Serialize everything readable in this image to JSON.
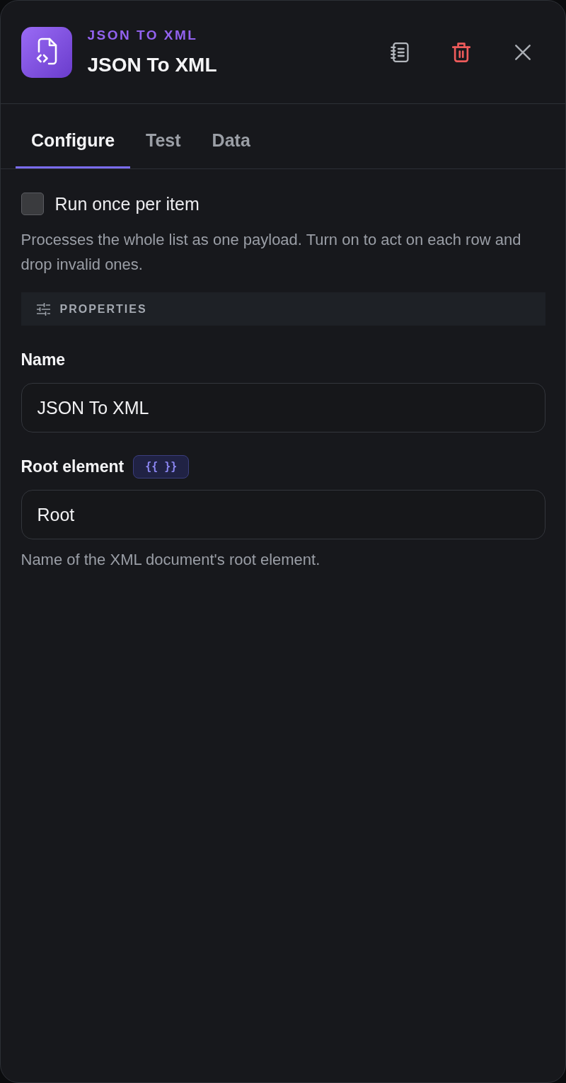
{
  "header": {
    "category": "JSON TO XML",
    "title": "JSON To XML"
  },
  "tabs": [
    {
      "label": "Configure",
      "selected": true
    },
    {
      "label": "Test",
      "selected": false
    },
    {
      "label": "Data",
      "selected": false
    }
  ],
  "run_once": {
    "label": "Run once per item",
    "checked": false,
    "description": "Processes the whole list as one payload. Turn on to act on each row and drop invalid ones."
  },
  "section": {
    "title": "PROPERTIES"
  },
  "fields": [
    {
      "label": "Name",
      "value": "JSON To XML"
    },
    {
      "label": "Root element",
      "badge": "{{ }}",
      "value": "Root",
      "help": "Name of the XML document's root element."
    }
  ]
}
